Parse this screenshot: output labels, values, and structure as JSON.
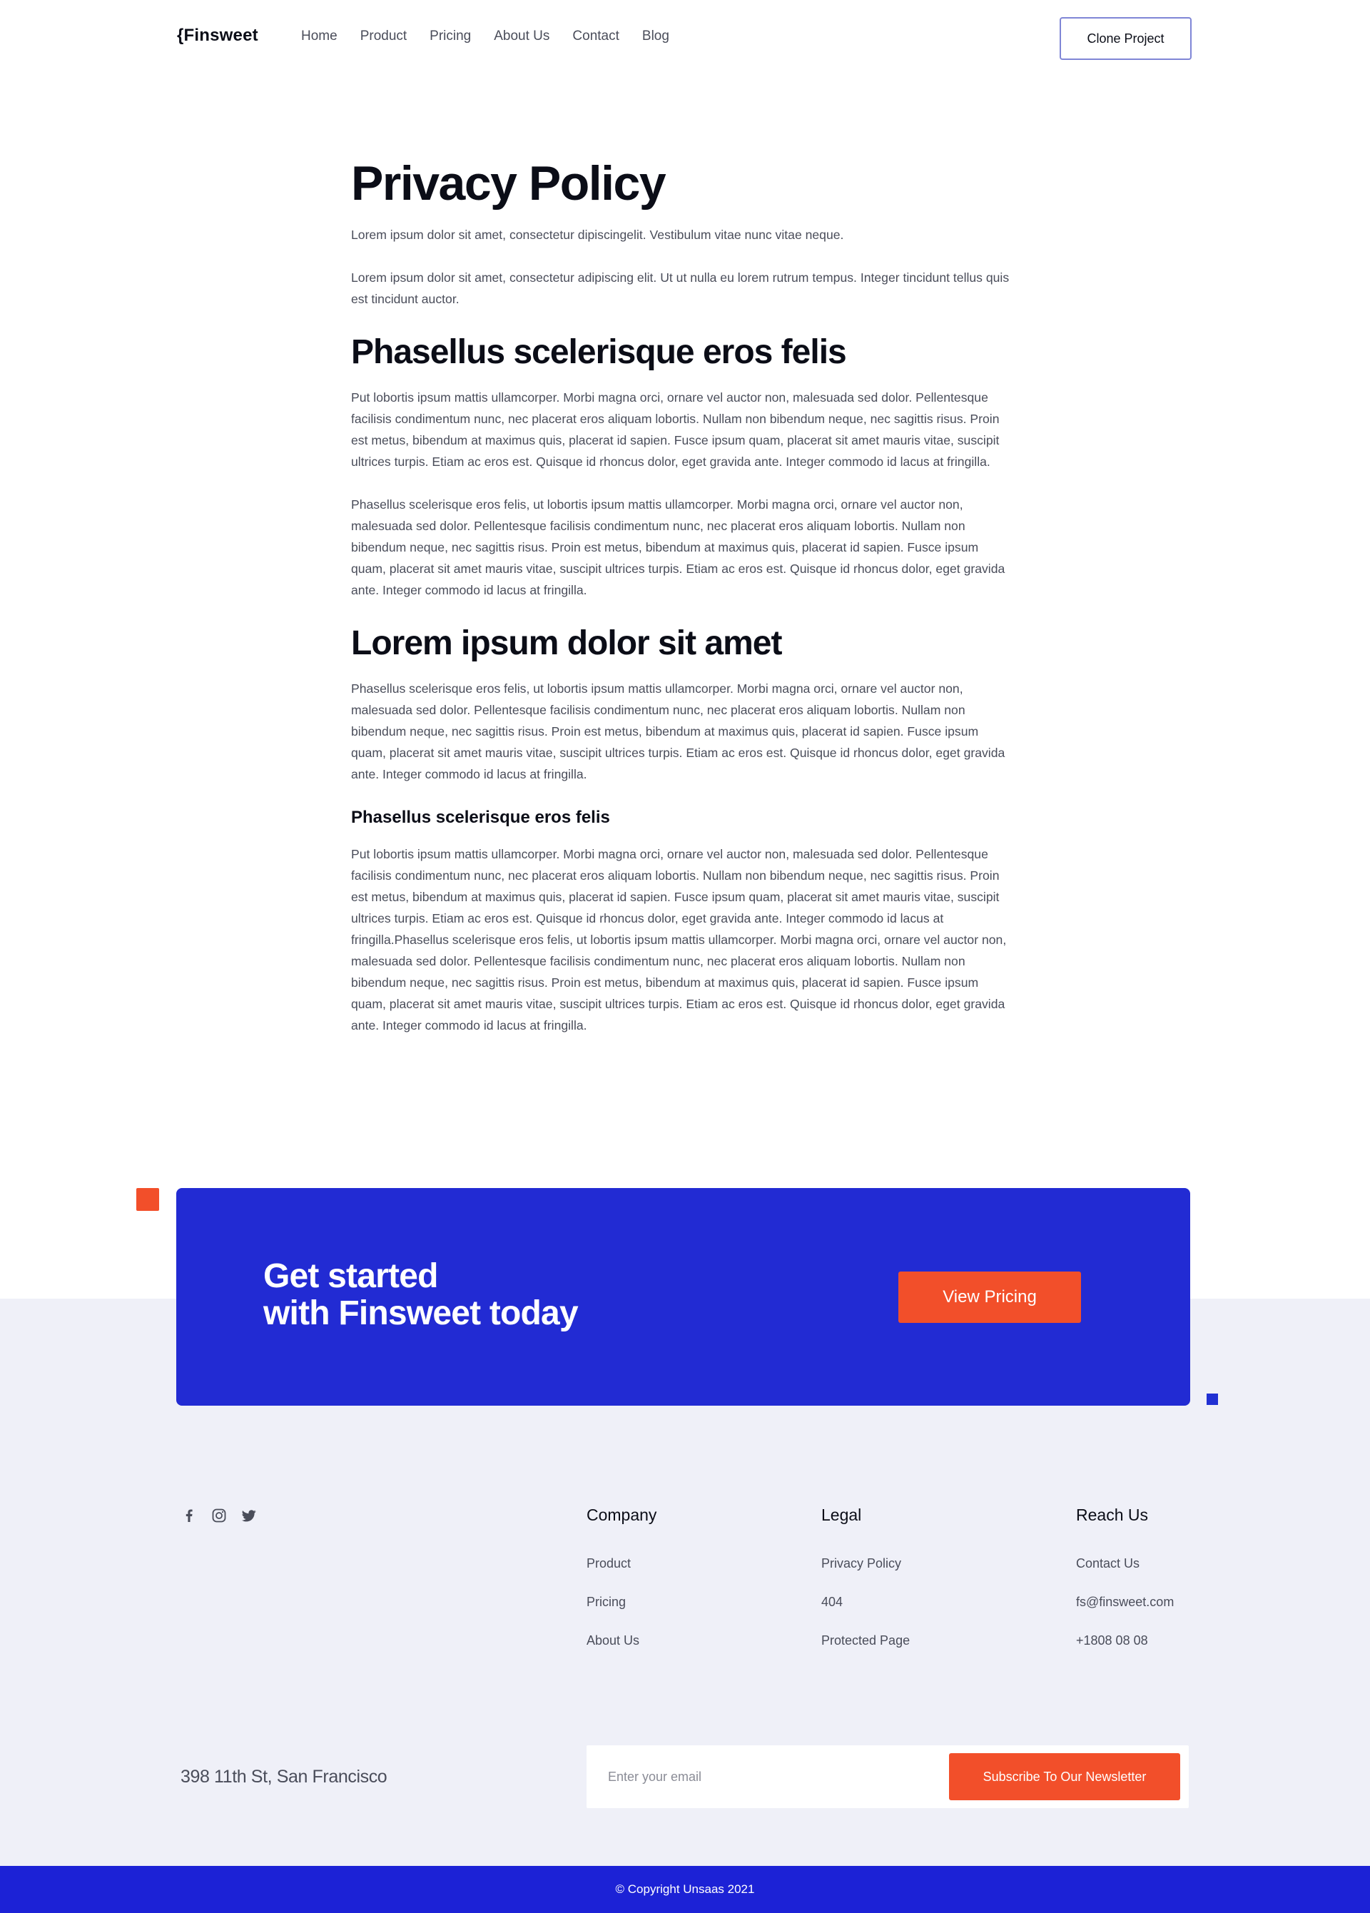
{
  "nav": {
    "logo": "{Finsweet",
    "links": [
      "Home",
      "Product",
      "Pricing",
      "About Us",
      "Contact",
      "Blog"
    ],
    "cta_label": "Clone Project"
  },
  "article": {
    "title": "Privacy Policy",
    "intro_1": "Lorem ipsum dolor sit amet, consectetur dipiscingelit. Vestibulum vitae nunc vitae neque.",
    "intro_2": "Lorem ipsum dolor sit amet, consectetur adipiscing elit. Ut ut nulla eu lorem rutrum tempus. Integer tincidunt tellus quis est tincidunt auctor.",
    "section_1": {
      "heading": "Phasellus scelerisque eros felis",
      "p1": "Put lobortis ipsum mattis ullamcorper. Morbi magna orci, ornare vel auctor non, malesuada sed dolor. Pellentesque facilisis condimentum nunc, nec placerat eros aliquam lobortis. Nullam non bibendum neque, nec sagittis risus. Proin est metus, bibendum at maximus quis, placerat id sapien. Fusce ipsum quam, placerat sit amet mauris vitae, suscipit ultrices turpis. Etiam ac eros est. Quisque id rhoncus dolor, eget gravida ante. Integer commodo id lacus at fringilla.",
      "p2": "Phasellus scelerisque eros felis, ut lobortis ipsum mattis ullamcorper. Morbi magna orci, ornare vel auctor non, malesuada sed dolor. Pellentesque facilisis condimentum nunc, nec placerat eros aliquam lobortis. Nullam non bibendum neque, nec sagittis risus. Proin est metus, bibendum at maximus quis, placerat id sapien. Fusce ipsum quam, placerat sit amet mauris vitae, suscipit ultrices turpis. Etiam ac eros est. Quisque id rhoncus dolor, eget gravida ante. Integer commodo id lacus at fringilla."
    },
    "section_2": {
      "heading": "Lorem ipsum dolor sit amet",
      "p1": "Phasellus scelerisque eros felis, ut lobortis ipsum mattis ullamcorper. Morbi magna orci, ornare vel auctor non, malesuada sed dolor. Pellentesque facilisis condimentum nunc, nec placerat eros aliquam lobortis. Nullam non bibendum neque, nec sagittis risus. Proin est metus, bibendum at maximus quis, placerat id sapien. Fusce ipsum quam, placerat sit amet mauris vitae, suscipit ultrices turpis. Etiam ac eros est. Quisque id rhoncus dolor, eget gravida ante. Integer commodo id lacus at fringilla."
    },
    "section_3": {
      "heading": "Phasellus scelerisque eros felis",
      "p1": "Put lobortis ipsum mattis ullamcorper. Morbi magna orci, ornare vel auctor non, malesuada sed dolor. Pellentesque facilisis condimentum nunc, nec placerat eros aliquam lobortis. Nullam non bibendum neque, nec sagittis risus. Proin est metus, bibendum at maximus quis, placerat id sapien. Fusce ipsum quam, placerat sit amet mauris vitae, suscipit ultrices turpis. Etiam ac eros est. Quisque id rhoncus dolor, eget gravida ante. Integer commodo id lacus at fringilla.Phasellus scelerisque eros felis, ut lobortis ipsum mattis ullamcorper. Morbi magna orci, ornare vel auctor non, malesuada sed dolor. Pellentesque facilisis condimentum nunc, nec placerat eros aliquam lobortis. Nullam non bibendum neque, nec sagittis risus. Proin est metus, bibendum at maximus quis, placerat id sapien. Fusce ipsum quam, placerat sit amet mauris vitae, suscipit ultrices turpis. Etiam ac eros est. Quisque id rhoncus dolor, eget gravida ante. Integer commodo id lacus at fringilla."
    }
  },
  "cta": {
    "title_line_1": "Get started",
    "title_line_2": "with Finsweet today",
    "button_label": "View Pricing"
  },
  "footer": {
    "social_icons": [
      "facebook-icon",
      "instagram-icon",
      "twitter-icon"
    ],
    "company": {
      "heading": "Company",
      "links": [
        "Product",
        "Pricing",
        "About Us"
      ]
    },
    "legal": {
      "heading": "Legal",
      "links": [
        "Privacy Policy",
        "404",
        "Protected Page"
      ]
    },
    "reach": {
      "heading": "Reach Us",
      "links": [
        "Contact Us",
        "fs@finsweet.com",
        "+1808 08 08"
      ]
    },
    "address": "398 11th St, San Francisco",
    "newsletter": {
      "placeholder": "Enter your email",
      "button_label": "Subscribe To Our Newsletter"
    },
    "copyright": "© Copyright Unsaas 2021"
  },
  "colors": {
    "brand_blue": "#222bd3",
    "accent_orange": "#f24f2a",
    "footer_bg": "#eff0f8",
    "heading": "#0b0d17",
    "body_text": "#4a4d5a"
  }
}
